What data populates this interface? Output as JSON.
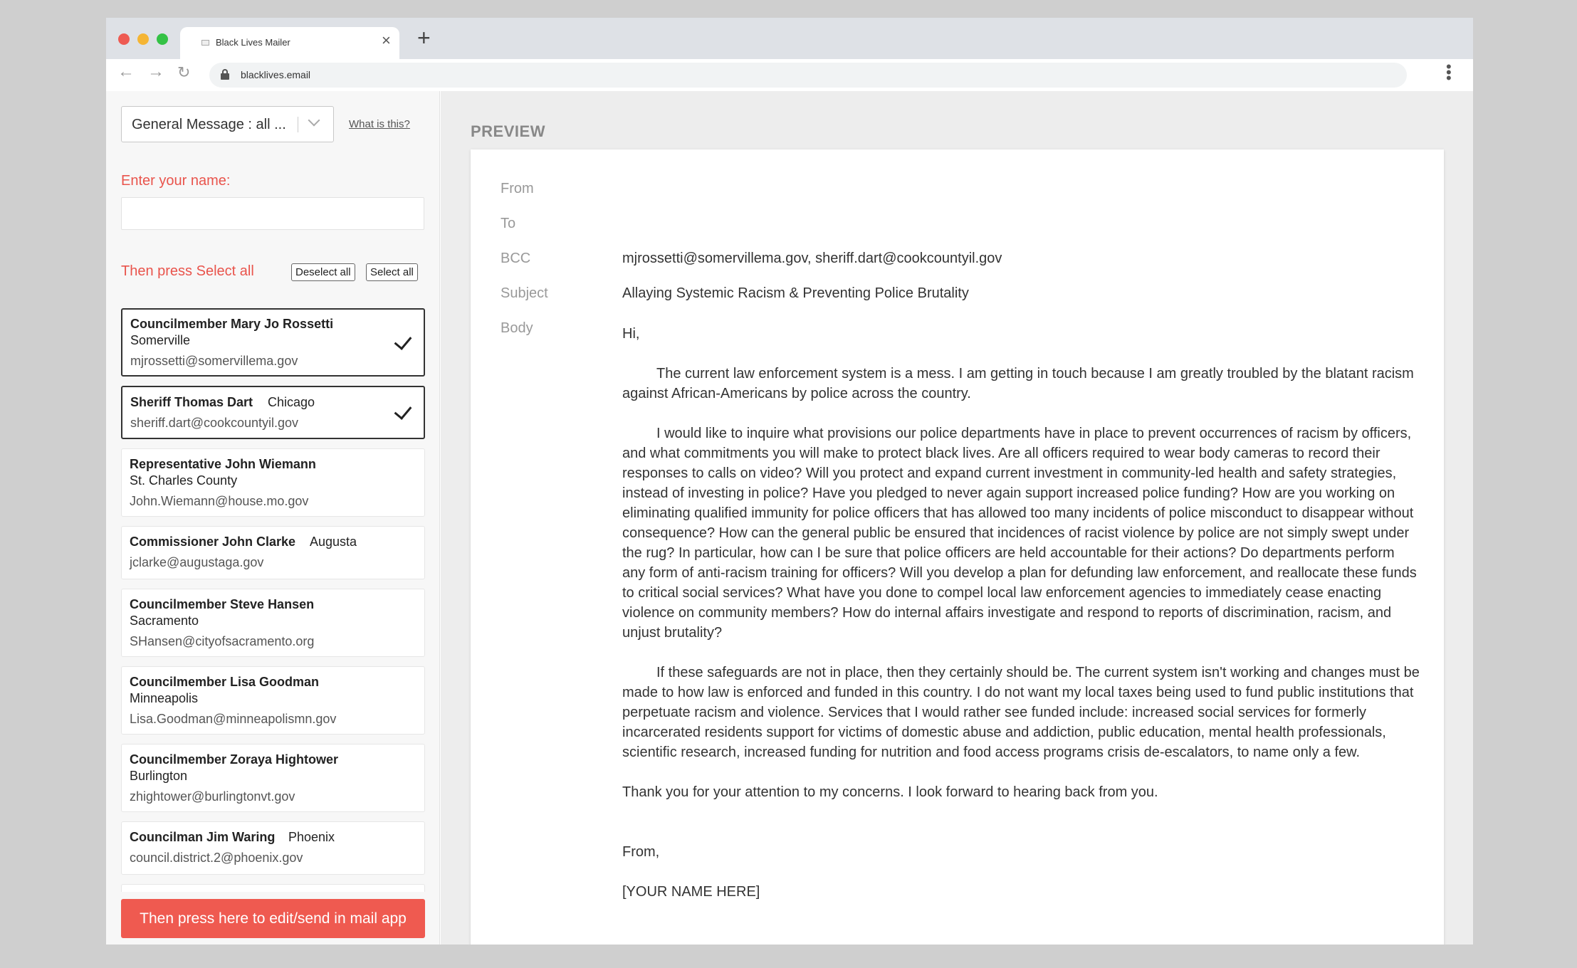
{
  "browser": {
    "tab_title": "Black Lives Mailer",
    "tab_close": "×",
    "new_tab": "+",
    "url": "blacklives.email"
  },
  "sidebar": {
    "template_value": "General Message : all ...",
    "what_link": "What is this?",
    "name_label": "Enter your name:",
    "name_value": "",
    "select_label": "Then press Select all",
    "deselect_all": "Deselect all",
    "select_all": "Select all",
    "send_button": "Then press here to edit/send in mail app",
    "contacts": [
      {
        "role": "Councilmember Mary Jo Rossetti",
        "city": "Somerville",
        "email": "mjrossetti@somervillema.gov",
        "selected": true
      },
      {
        "role": "Sheriff Thomas Dart",
        "city": "Chicago",
        "email": "sheriff.dart@cookcountyil.gov",
        "selected": true
      },
      {
        "role": "Representative John Wiemann",
        "city": "St. Charles County",
        "email": "John.Wiemann@house.mo.gov",
        "selected": false
      },
      {
        "role": "Commissioner John Clarke",
        "city": "Augusta",
        "email": "jclarke@augustaga.gov",
        "selected": false
      },
      {
        "role": "Councilmember Steve Hansen",
        "city": "Sacramento",
        "email": "SHansen@cityofsacramento.org",
        "selected": false
      },
      {
        "role": "Councilmember Lisa Goodman",
        "city": "Minneapolis",
        "email": "Lisa.Goodman@minneapolismn.gov",
        "selected": false
      },
      {
        "role": "Councilmember Zoraya Hightower",
        "city": "Burlington",
        "email": "zhightower@burlingtonvt.gov",
        "selected": false
      },
      {
        "role": "Councilman Jim Waring",
        "city": "Phoenix",
        "email": "council.district.2@phoenix.gov",
        "selected": false
      }
    ]
  },
  "preview": {
    "title": "PREVIEW",
    "from_label": "From",
    "to_label": "To",
    "bcc_label": "BCC",
    "subject_label": "Subject",
    "body_label": "Body",
    "from_value": "",
    "to_value": "",
    "bcc_value": "mjrossetti@somervillema.gov, sheriff.dart@cookcountyil.gov",
    "subject_value": "Allaying Systemic Racism & Preventing Police Brutality",
    "greeting": "Hi,",
    "paragraph_1": "The current law enforcement system is a mess. I am getting in touch because I am greatly troubled by the blatant racism against African-Americans by police across the country.",
    "paragraph_2": "I would like to inquire what provisions our police departments have in place to prevent occurrences of racism by officers, and what commitments you will make to protect black lives. Are all officers required to wear body cameras to record their responses to calls on video? Will you protect and expand current investment in community-led health and safety strategies, instead of investing in police? Have you pledged to never again support increased police funding? How are you working on eliminating qualified immunity for police officers that has allowed too many incidents of police misconduct to disappear without consequence? How can the general public be ensured that incidences of racist violence by police are not simply swept under the rug? In particular, how can I be sure that police officers are held accountable for their actions? Do departments perform any form of anti-racism training for officers? Will you develop a plan for defunding law enforcement, and reallocate these funds to critical social services? What have you done to compel local law enforcement agencies to immediately cease enacting violence on community members? How do internal affairs investigate and respond to reports of discrimination, racism, and unjust brutality?",
    "paragraph_3": "If these safeguards are not in place, then they certainly should be. The current system isn't working and changes must be made to how law is enforced and funded in this country. I do not want my local taxes being used to fund public institutions that perpetuate racism and violence. Services that I would rather see funded include: increased social services for formerly incarcerated residents support for victims of domestic abuse and addiction, public education, mental health professionals, scientific research, increased funding for nutrition and food access programs crisis de-escalators, to name only a few.",
    "closing": "Thank you for your attention to my concerns. I look forward to hearing back from you.",
    "signoff": "From,",
    "signature": "[YOUR NAME HERE]"
  },
  "colors": {
    "accent": "#ef5a50",
    "label_red": "#e9544c",
    "background": "#cfcfcf"
  },
  "icons": [
    "back-arrow-icon",
    "forward-arrow-icon",
    "reload-icon",
    "lock-icon",
    "menu-dots-icon",
    "close-icon",
    "chevron-down-icon",
    "checkmark-icon"
  ]
}
